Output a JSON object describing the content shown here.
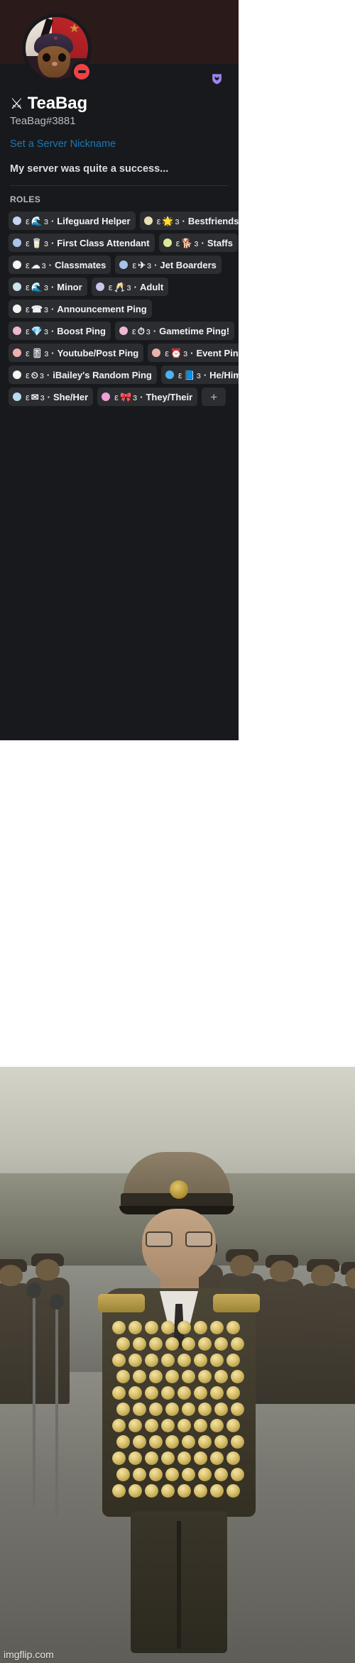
{
  "profile": {
    "display_name": "TeaBag",
    "display_name_glyph": "⚔",
    "username": "TeaBag#3881",
    "nickname_link": "Set a Server Nickname",
    "about_me": "My server was quite a success...",
    "status": "dnd",
    "status_icon": "do-not-disturb-icon",
    "avatar_alt": "cat-in-ushanka-avatar",
    "banner_color": "#2b1a1a",
    "badge_icon": "hypesquad-bravery-badge",
    "badge_color": "#9b84ec"
  },
  "roles_section": {
    "heading": "ROLES",
    "add_button_label": "+",
    "items": [
      {
        "name": "Lifeguard Helper",
        "emoji": "🌊",
        "dot_color": "#c3d4ef",
        "prefix": "ε",
        "suffix": "ɜ",
        "separator": "·"
      },
      {
        "name": "Bestfriends!",
        "emoji": "🌟",
        "dot_color": "#e9dfb4",
        "prefix": "ε",
        "suffix": "ɜ",
        "separator": "·"
      },
      {
        "name": "First Class Attendant",
        "emoji": "🥛",
        "dot_color": "#abc5ea",
        "prefix": "ε",
        "suffix": "ɜ",
        "separator": "·"
      },
      {
        "name": "Staffs",
        "emoji": "🐕",
        "dot_color": "#dbe89a",
        "prefix": "ε",
        "suffix": "ɜ",
        "separator": "·"
      },
      {
        "name": "Classmates",
        "emoji": "☁",
        "dot_color": "#f7f7f7",
        "prefix": "ε",
        "suffix": "ɜ",
        "separator": "·"
      },
      {
        "name": "Jet Boarders",
        "emoji": "✈",
        "dot_color": "#a9c3ec",
        "prefix": "ε",
        "suffix": "ɜ",
        "separator": "·"
      },
      {
        "name": "Minor",
        "emoji": "🌊",
        "dot_color": "#c9e4ee",
        "prefix": "ε",
        "suffix": "ɜ",
        "separator": "·"
      },
      {
        "name": "Adult",
        "emoji": "🥂",
        "dot_color": "#cdc3ea",
        "prefix": "ε",
        "suffix": "ɜ",
        "separator": "·"
      },
      {
        "name": "Announcement Ping",
        "emoji": "☎",
        "dot_color": "#f4f3f1",
        "prefix": "ε",
        "suffix": "ɜ",
        "separator": "·"
      },
      {
        "name": "Boost Ping",
        "emoji": "💎",
        "dot_color": "#edb9cd",
        "prefix": "ε",
        "suffix": "ɜ",
        "separator": "·"
      },
      {
        "name": "Gametime Ping!",
        "emoji": "⏱",
        "dot_color": "#efb7d4",
        "prefix": "ε",
        "suffix": "ɜ",
        "separator": "·"
      },
      {
        "name": "Youtube/Post Ping",
        "emoji": "🎚",
        "dot_color": "#eeb0b0",
        "prefix": "ε",
        "suffix": "ɜ",
        "separator": "·"
      },
      {
        "name": "Event Ping",
        "emoji": "⏰",
        "dot_color": "#e9b2ad",
        "prefix": "ε",
        "suffix": "ɜ",
        "separator": "·"
      },
      {
        "name": "iBailey's Random Ping",
        "emoji": "⏲",
        "dot_color": "#f6f5f3",
        "prefix": "ε",
        "suffix": "ɜ",
        "separator": "·"
      },
      {
        "name": "He/Him",
        "emoji": "📘",
        "dot_color": "#4fb3f0",
        "prefix": "ε",
        "suffix": "ɜ",
        "separator": "·"
      },
      {
        "name": "She/Her",
        "emoji": "✉",
        "dot_color": "#b7dcf0",
        "prefix": "ε",
        "suffix": "ɜ",
        "separator": "·"
      },
      {
        "name": "They/Their",
        "emoji": "🎀",
        "dot_color": "#f0a0d6",
        "prefix": "ε",
        "suffix": "ɜ",
        "separator": "·"
      }
    ]
  },
  "meme": {
    "image_caption": "north-korean-general-covered-in-medals",
    "watermark": "imgflip.com"
  }
}
